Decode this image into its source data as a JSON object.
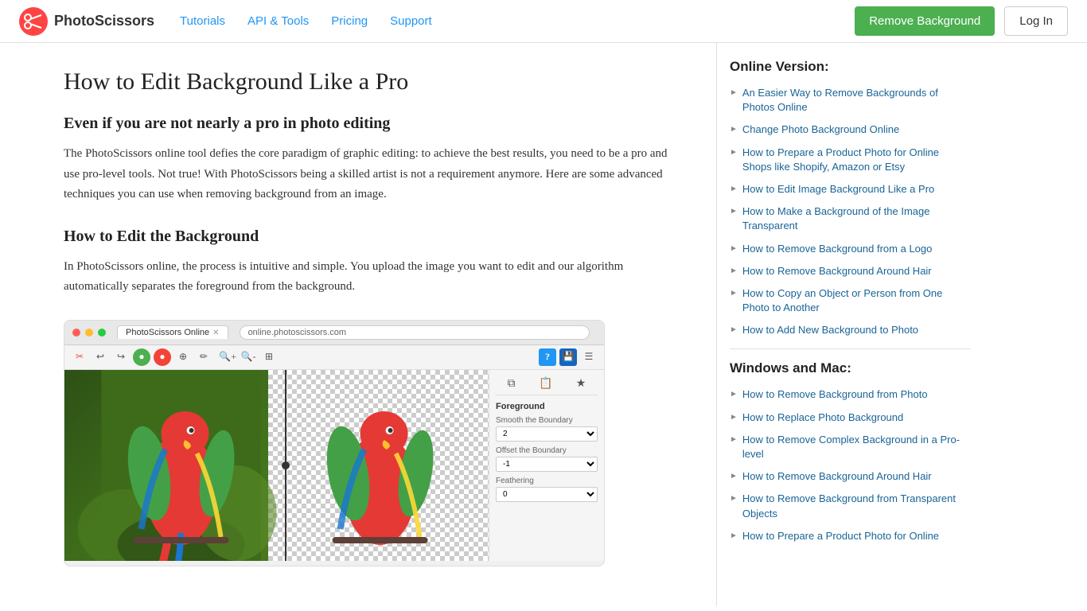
{
  "header": {
    "logo_text": "PhotoScissors",
    "nav_items": [
      {
        "label": "Tutorials",
        "href": "#"
      },
      {
        "label": "API & Tools",
        "href": "#"
      },
      {
        "label": "Pricing",
        "href": "#"
      },
      {
        "label": "Support",
        "href": "#"
      }
    ],
    "remove_bg_btn": "Remove Background",
    "login_btn": "Log In"
  },
  "main": {
    "page_title": "How to Edit Background Like a Pro",
    "section1_heading": "Even if you are not nearly a pro in photo editing",
    "section1_text": "The PhotoScissors online tool defies the core paradigm of graphic editing: to achieve the best results, you need to be a pro and use pro-level tools. Not true! With PhotoScissors being a skilled artist is not a requirement anymore. Here are some advanced techniques you can use when removing background from an image.",
    "section2_heading": "How to Edit the Background",
    "section2_text": "In PhotoScissors online, the process is intuitive and simple. You upload the image you want to edit and our algorithm automatically separates the foreground from the background."
  },
  "browser_chrome": {
    "tab_label": "PhotoScissors Online",
    "address": "online.photoscissors.com"
  },
  "settings_panel": {
    "section_title": "Foreground",
    "smooth_label": "Smooth the Boundary",
    "smooth_value": "2",
    "offset_label": "Offset the Boundary",
    "offset_value": "-1",
    "feathering_label": "Feathering",
    "feathering_value": "0"
  },
  "sidebar": {
    "online_section_title": "Online Version:",
    "online_links": [
      "An Easier Way to Remove Backgrounds of Photos Online",
      "Change Photo Background Online",
      "How to Prepare a Product Photo for Online Shops like Shopify, Amazon or Etsy",
      "How to Edit Image Background Like a Pro",
      "How to Make a Background of the Image Transparent",
      "How to Remove Background from a Logo",
      "How to Remove Background Around Hair",
      "How to Copy an Object or Person from One Photo to Another",
      "How to Add New Background to Photo"
    ],
    "windows_section_title": "Windows and Mac:",
    "windows_links": [
      "How to Remove Background from Photo",
      "How to Replace Photo Background",
      "How to Remove Complex Background in a Pro-level",
      "How to Remove Background Around Hair",
      "How to Remove Background from Transparent Objects",
      "How to Prepare a Product Photo for Online"
    ]
  }
}
